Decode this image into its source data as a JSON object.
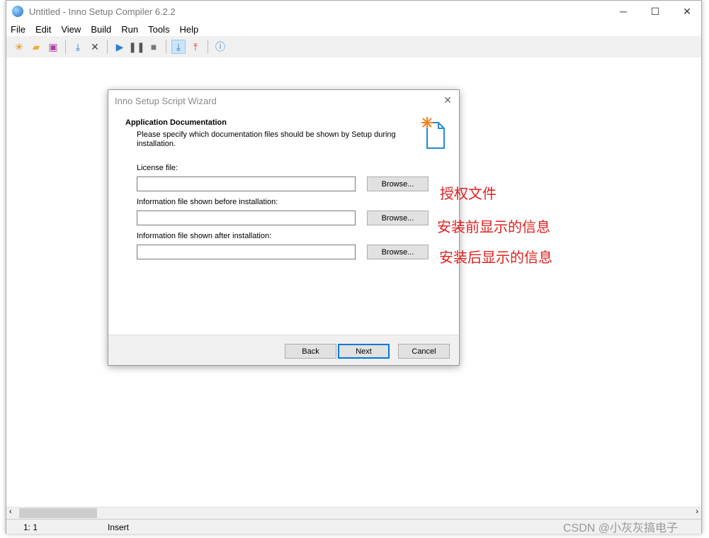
{
  "window": {
    "title": "Untitled - Inno Setup Compiler 6.2.2",
    "minimize": "─",
    "maximize": "☐",
    "close": "✕"
  },
  "menu": [
    "File",
    "Edit",
    "View",
    "Build",
    "Run",
    "Tools",
    "Help"
  ],
  "toolbar": [
    "new-file",
    "open-file",
    "save",
    "compile",
    "stop-compile",
    "run",
    "pause",
    "terminate",
    "target-setup",
    "target-uninstall",
    "help"
  ],
  "status": {
    "position": "1:  1",
    "mode": "Insert"
  },
  "dialog": {
    "title": "Inno Setup Script Wizard",
    "close": "✕",
    "heading": "Application Documentation",
    "description": "Please specify which documentation files should be shown by Setup during installation.",
    "fields": [
      {
        "label": "License file:",
        "value": "",
        "browse": "Browse..."
      },
      {
        "label": "Information file shown before installation:",
        "value": "",
        "browse": "Browse..."
      },
      {
        "label": "Information file shown after installation:",
        "value": "",
        "browse": "Browse..."
      }
    ],
    "back": "Back",
    "next": "Next",
    "cancel": "Cancel"
  },
  "annotations": [
    "授权文件",
    "安装前显示的信息",
    "安装后显示的信息"
  ],
  "watermark": "CSDN @小灰灰搞电子"
}
